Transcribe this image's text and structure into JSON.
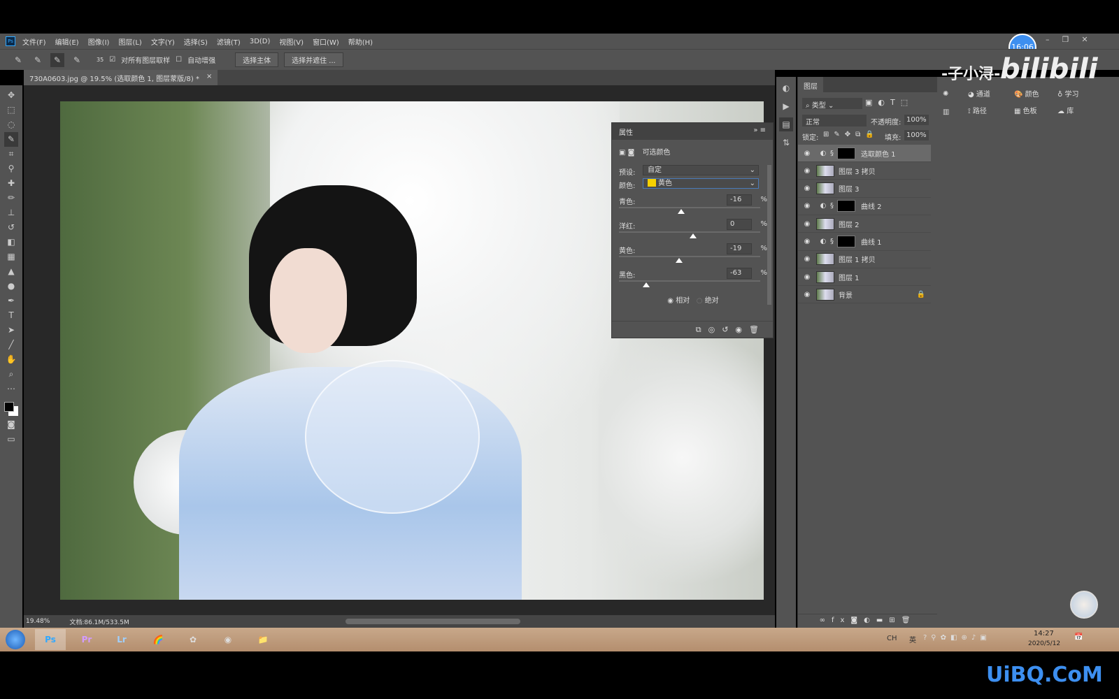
{
  "app": {
    "logo": "Ps",
    "menu": [
      "文件(F)",
      "编辑(E)",
      "图像(I)",
      "图层(L)",
      "文字(Y)",
      "选择(S)",
      "滤镜(T)",
      "3D(D)",
      "视图(V)",
      "窗口(W)",
      "帮助(H)"
    ],
    "clock_badge": "16:06"
  },
  "options": {
    "brush_size": "35",
    "sample_all_label": "对所有图层取样",
    "sample_all_checked": true,
    "auto_enhance_label": "自动增强",
    "auto_enhance_checked": false,
    "select_subject": "选择主体",
    "select_mask": "选择并遮住 ..."
  },
  "document": {
    "tab_title": "730A0603.jpg @ 19.5% (选取颜色 1, 图层蒙版/8) *",
    "zoom": "19.48%",
    "doc_info": "文档:86.1M/533.5M"
  },
  "properties": {
    "title": "属性",
    "adjustment": "可选颜色",
    "preset_label": "预设:",
    "preset_value": "自定",
    "colors_label": "颜色:",
    "colors_value": "黄色",
    "swatch": "#f5d000",
    "sliders": [
      {
        "label": "青色:",
        "value": "-16"
      },
      {
        "label": "洋红:",
        "value": "0"
      },
      {
        "label": "黄色:",
        "value": "-19"
      },
      {
        "label": "黑色:",
        "value": "-63"
      }
    ],
    "percent": "%",
    "method_relative": "相对",
    "method_absolute": "绝对",
    "method_selected": "relative"
  },
  "layers": {
    "tab": "图层",
    "filter": "类型",
    "blend": "正常",
    "opacity_label": "不透明度:",
    "opacity": "100%",
    "lock_label": "锁定:",
    "fill_label": "填充:",
    "fill": "100%",
    "items": [
      {
        "name": "选取颜色 1",
        "type": "adjustment",
        "selected": true
      },
      {
        "name": "图层 3 拷贝",
        "type": "pixel"
      },
      {
        "name": "图层 3",
        "type": "pixel"
      },
      {
        "name": "曲线 2",
        "type": "adjustment"
      },
      {
        "name": "图层 2",
        "type": "pixel"
      },
      {
        "name": "曲线 1",
        "type": "adjustment"
      },
      {
        "name": "图层 1 拷贝",
        "type": "pixel"
      },
      {
        "name": "图层 1",
        "type": "pixel"
      },
      {
        "name": "背景",
        "type": "pixel",
        "locked": true
      }
    ]
  },
  "side_panels": [
    {
      "label": "通道"
    },
    {
      "label": "路径"
    },
    {
      "label": "颜色"
    },
    {
      "label": "色板"
    },
    {
      "label": "学习"
    },
    {
      "label": "库"
    }
  ],
  "watermark": {
    "uploader": "-子小浔-",
    "brand": "bilibili",
    "site": "UiBQ.CoM"
  },
  "taskbar": {
    "apps": [
      "Ps",
      "Pr",
      "Lr"
    ],
    "ime": "CH",
    "ime_mode": "英",
    "time": "14:27",
    "date": "2020/5/12"
  }
}
